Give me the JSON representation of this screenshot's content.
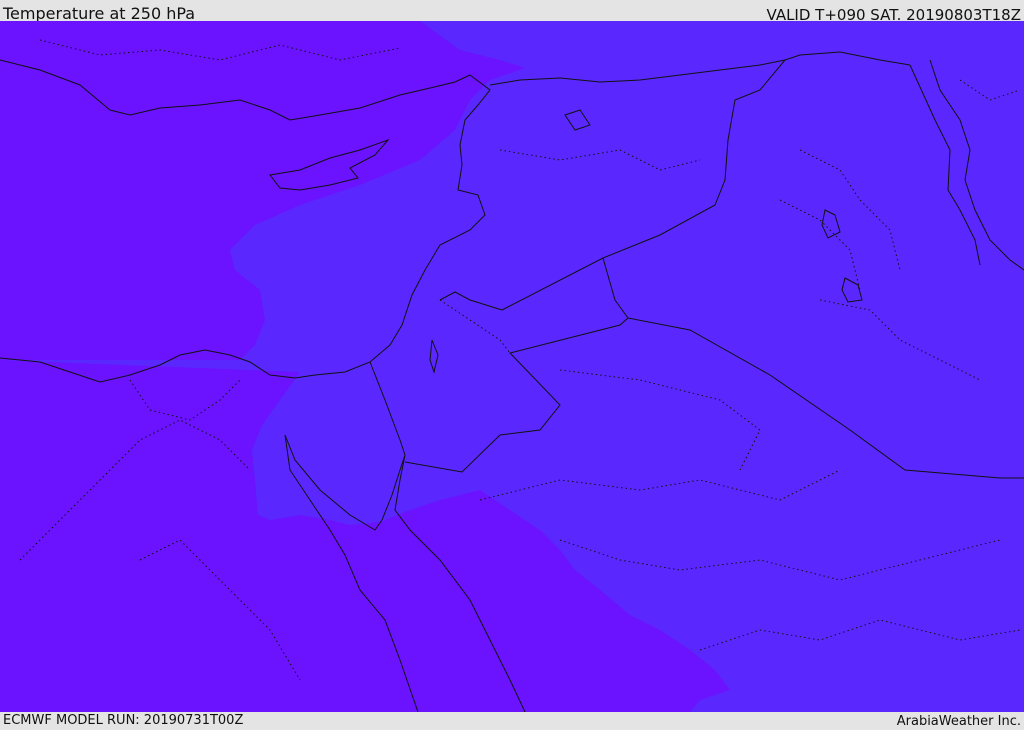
{
  "header": {
    "title": "Temperature at 250 hPa",
    "valid_time": "VALID T+090 SAT. 20190803T18Z"
  },
  "footer": {
    "model_run": "ECMWF MODEL RUN: 20190731T00Z",
    "credit": "ArabiaWeather Inc."
  },
  "map": {
    "field": "temperature",
    "level": "250 hPa",
    "colors": {
      "warmer_band": "#6b12ff",
      "cooler_band": "#5a28ff",
      "coastline": "#111111",
      "borders": "#111111"
    },
    "borders_style": "solid national borders, dotted internal boundaries"
  }
}
